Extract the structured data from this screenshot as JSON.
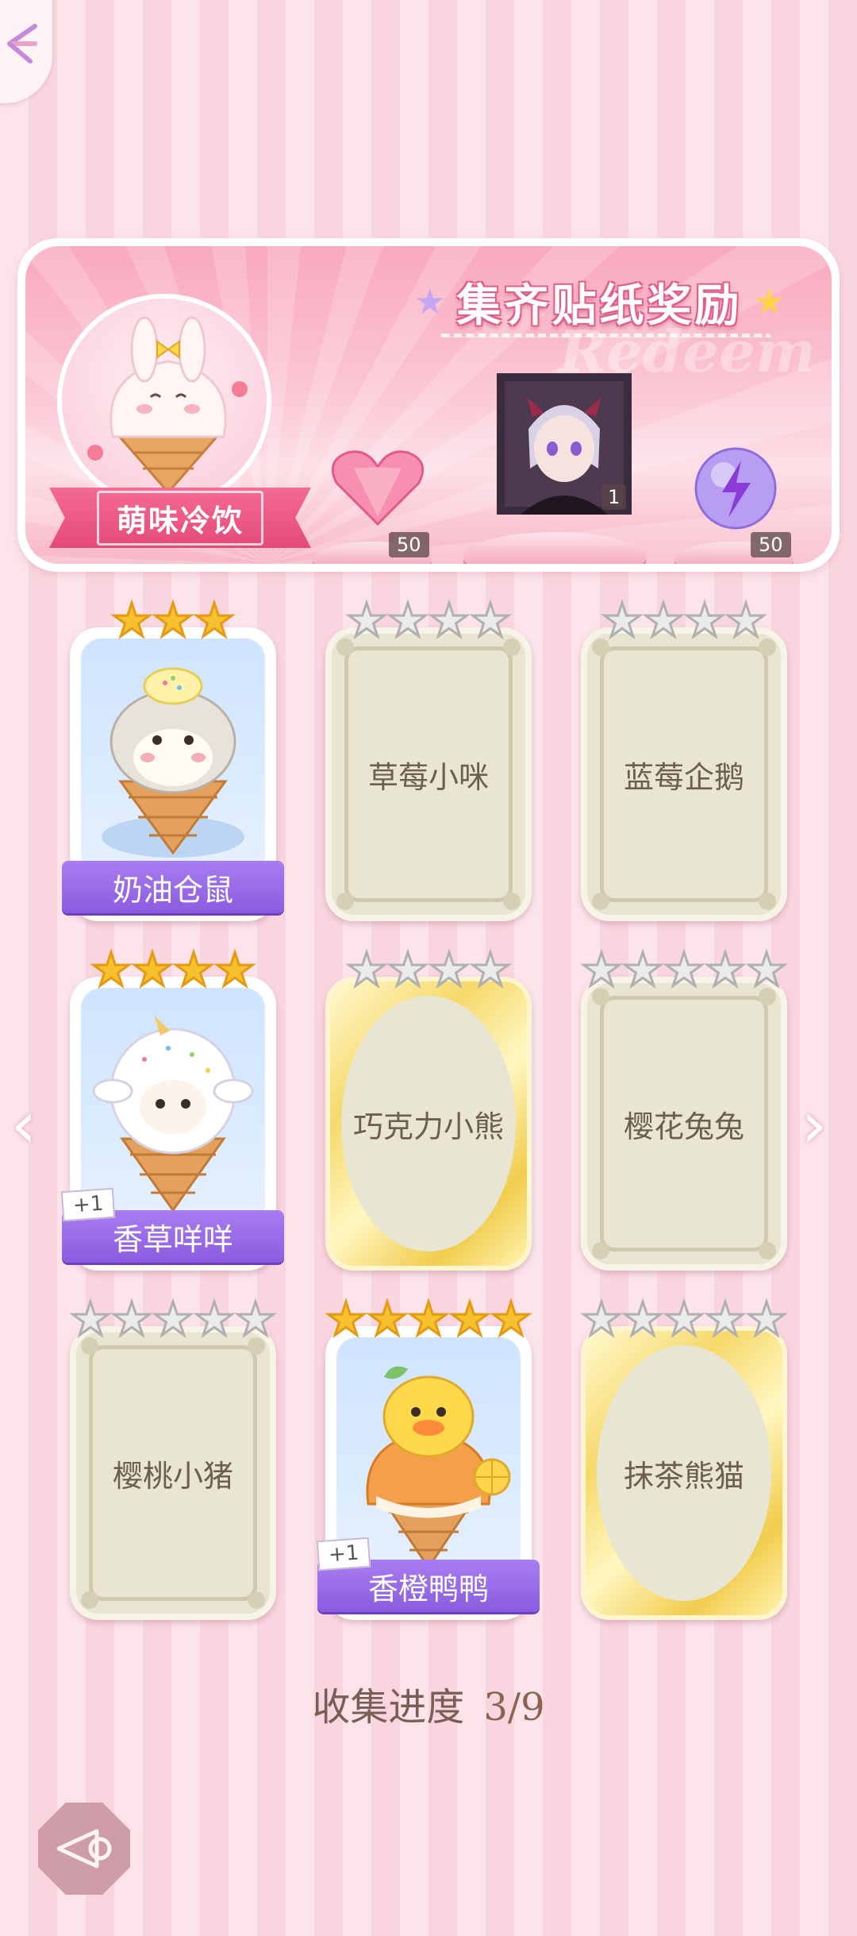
{
  "reward": {
    "title": "集齐贴纸奖励",
    "watermark": "Redeem",
    "collection_name": "萌味冷饮",
    "items": [
      {
        "icon": "pink-heart-gem-icon",
        "count": "50"
      },
      {
        "icon": "character-portrait",
        "count": "1"
      },
      {
        "icon": "purple-energy-orb-icon",
        "count": "50"
      }
    ]
  },
  "stickers": [
    {
      "name": "奶油仓鼠",
      "stars_total": 3,
      "stars_earned": 3,
      "state": "unlocked",
      "bonus": ""
    },
    {
      "name": "草莓小咪",
      "stars_total": 4,
      "stars_earned": 0,
      "state": "locked",
      "bonus": ""
    },
    {
      "name": "蓝莓企鹅",
      "stars_total": 4,
      "stars_earned": 0,
      "state": "locked",
      "bonus": ""
    },
    {
      "name": "香草咩咩",
      "stars_total": 4,
      "stars_earned": 4,
      "state": "unlocked",
      "bonus": "+1"
    },
    {
      "name": "巧克力小熊",
      "stars_total": 4,
      "stars_earned": 0,
      "state": "locked-gold",
      "bonus": ""
    },
    {
      "name": "樱花兔兔",
      "stars_total": 5,
      "stars_earned": 0,
      "state": "locked",
      "bonus": ""
    },
    {
      "name": "樱桃小猪",
      "stars_total": 5,
      "stars_earned": 0,
      "state": "locked",
      "bonus": ""
    },
    {
      "name": "香橙鸭鸭",
      "stars_total": 5,
      "stars_earned": 5,
      "state": "unlocked",
      "bonus": "+1"
    },
    {
      "name": "抹茶熊猫",
      "stars_total": 5,
      "stars_earned": 0,
      "state": "locked-gold",
      "bonus": ""
    }
  ],
  "progress": {
    "label": "收集进度",
    "value": "3/9"
  },
  "nav": {
    "prev": "‹",
    "next": "›"
  },
  "colors": {
    "accent_pink": "#e44a78",
    "name_plate_purple": "#8b5ce0",
    "star_gold": "#f6c12d"
  }
}
